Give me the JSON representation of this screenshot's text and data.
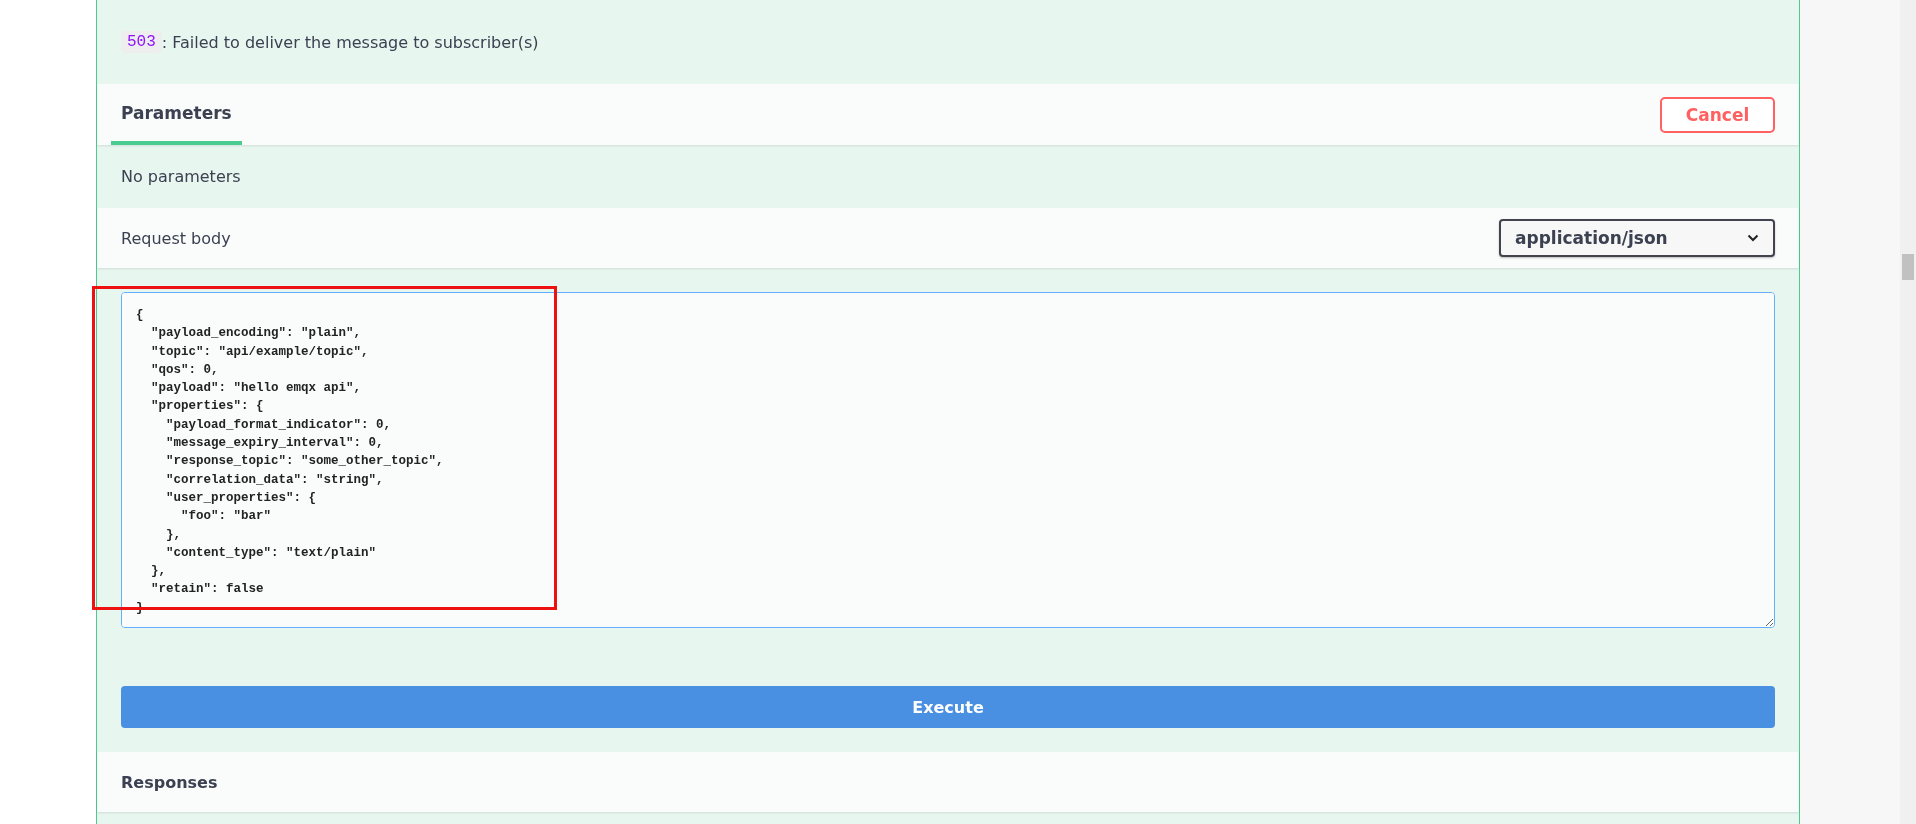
{
  "responses_list": [
    {
      "code": "503",
      "description": ": Failed to deliver the message to subscriber(s)"
    }
  ],
  "tabs": [
    {
      "label": "Parameters",
      "selected": true
    }
  ],
  "cancel_button": "Cancel",
  "parameters_message": "No parameters",
  "request_body": {
    "label": "Request body",
    "content_type": "application/json",
    "value": "{\n  \"payload_encoding\": \"plain\",\n  \"topic\": \"api/example/topic\",\n  \"qos\": 0,\n  \"payload\": \"hello emqx api\",\n  \"properties\": {\n    \"payload_format_indicator\": 0,\n    \"message_expiry_interval\": 0,\n    \"response_topic\": \"some_other_topic\",\n    \"correlation_data\": \"string\",\n    \"user_properties\": {\n      \"foo\": \"bar\"\n    },\n    \"content_type\": \"text/plain\"\n  },\n  \"retain\": false\n}"
  },
  "execute_button": "Execute",
  "responses_title": "Responses"
}
